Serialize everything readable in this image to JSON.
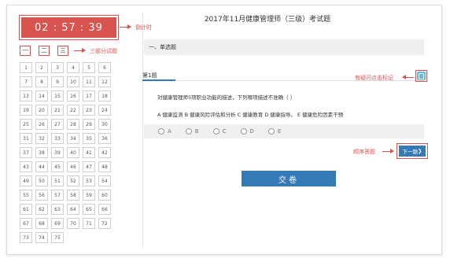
{
  "timer": {
    "value": "02 : 57 : 39",
    "annotation": "倒计时"
  },
  "parts": {
    "buttons": [
      "一",
      "二",
      "三"
    ],
    "annotation": "三部分试题"
  },
  "exam": {
    "title": "2017年11月健康管理师（三级）考试题"
  },
  "section": {
    "label": "一、单选题"
  },
  "question": {
    "number": "第1题",
    "text": "对健康管理师5项职业功能的描述，下列哪项描述不准确（ ）",
    "options_text": "A 健康监测 B 健康风险评估和分析 C 健康教育 D 健康指导。 E 健康危险因素干预",
    "choices": [
      "A",
      "B",
      "C",
      "D",
      "E"
    ]
  },
  "mark": {
    "annotation": "有疑问点击标记",
    "icon": "bookmark-icon"
  },
  "next": {
    "label": "下一题",
    "annotation": "顺序答题"
  },
  "submit": {
    "label": "交卷"
  },
  "grid": {
    "numbers": [
      "1",
      "2",
      "3",
      "4",
      "5",
      "6",
      "7",
      "8",
      "9",
      "10",
      "11",
      "12",
      "13",
      "14",
      "15",
      "16",
      "17",
      "18",
      "19",
      "20",
      "21",
      "22",
      "23",
      "24",
      "25",
      "26",
      "27",
      "28",
      "29",
      "30",
      "31",
      "32",
      "33",
      "34",
      "35",
      "36",
      "37",
      "38",
      "39",
      "40",
      "41",
      "42",
      "43",
      "44",
      "45",
      "46",
      "47",
      "48",
      "49",
      "50",
      "51",
      "52",
      "53",
      "54",
      "55",
      "56",
      "57",
      "58",
      "59",
      "60",
      "61",
      "62",
      "63",
      "64",
      "65",
      "66",
      "67",
      "68",
      "69",
      "70",
      "71",
      "72",
      "73",
      "74",
      "75"
    ]
  },
  "colors": {
    "accent_red": "#d9534f",
    "primary_blue": "#337ab7",
    "mark_teal": "#5bc0de"
  }
}
